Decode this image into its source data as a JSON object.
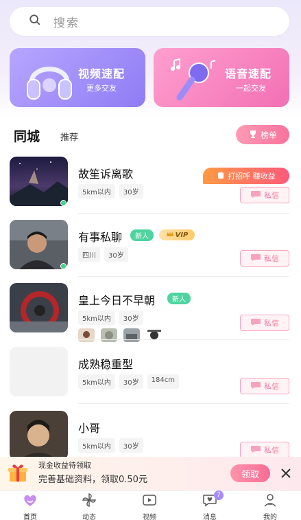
{
  "search": {
    "placeholder": "搜索"
  },
  "match_cards": [
    {
      "title": "视频速配",
      "subtitle": "更多交友",
      "icon": "headphones-icon"
    },
    {
      "title": "语音速配",
      "subtitle": "一起交友",
      "icon": "microphone-icon"
    }
  ],
  "section": {
    "title": "同城",
    "tab": "推荐",
    "rank_label": "榜单"
  },
  "promo_bubble": "打招呼 赚收益",
  "users": [
    {
      "name": "故笙诉离歌",
      "tags": [
        "5km以内",
        "30岁"
      ],
      "online": true,
      "msg": "私信"
    },
    {
      "name": "有事私聊",
      "badge": "新人",
      "vip": "VIP",
      "tags": [
        "四川",
        "30岁"
      ],
      "online": true,
      "msg": "私信"
    },
    {
      "name": "皇上今日不早朝",
      "badge": "新人",
      "tags": [
        "5km以内",
        "30岁"
      ],
      "msg": "私信"
    },
    {
      "name": "成熟稳重型",
      "tags": [
        "5km以内",
        "30岁",
        "184cm"
      ],
      "msg": "私信"
    },
    {
      "name": "小哥",
      "tags": [
        "5km以内",
        "30岁"
      ],
      "msg": "私信"
    }
  ],
  "banner": {
    "line1": "现金收益待领取",
    "line2": "完善基础资料，领取0.50元",
    "button": "领取"
  },
  "tabbar": [
    {
      "label": "首页",
      "icon": "home-icon",
      "active": true
    },
    {
      "label": "动态",
      "icon": "pinwheel-icon"
    },
    {
      "label": "视频",
      "icon": "video-icon"
    },
    {
      "label": "消息",
      "icon": "message-icon",
      "badge": "7"
    },
    {
      "label": "我的",
      "icon": "profile-icon"
    }
  ],
  "colors": {
    "accent_pink": "#f8739a",
    "accent_purple": "#8f7cf5",
    "online_green": "#3fd28b"
  }
}
